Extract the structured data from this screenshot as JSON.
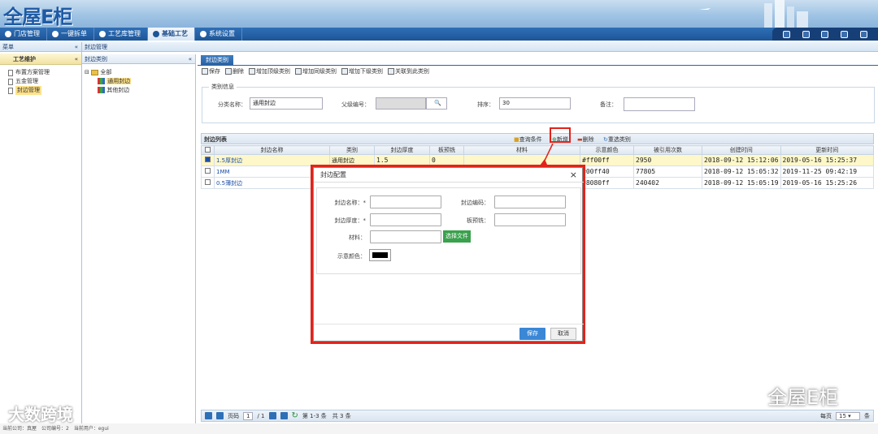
{
  "header": {
    "logo_text": "全屋E柜"
  },
  "nav": {
    "tabs": [
      {
        "label": "门店管理",
        "active": false
      },
      {
        "label": "一键拆单",
        "active": false
      },
      {
        "label": "工艺库管理",
        "active": false
      },
      {
        "label": "基础工艺",
        "active": true
      },
      {
        "label": "系统设置",
        "active": false
      }
    ]
  },
  "left_panel": {
    "bar_label": "菜单",
    "section_title": "工艺维护",
    "items": [
      {
        "label": "布置方案管理",
        "selected": false
      },
      {
        "label": "五金管理",
        "selected": false
      },
      {
        "label": "封边管理",
        "selected": true
      }
    ]
  },
  "breadcrumb": "封边管理",
  "middle_panel": {
    "title": "封边类别",
    "tree_root": "全部",
    "tree_children": [
      "通用封边",
      "其他封边"
    ]
  },
  "content": {
    "tab_label": "封边类别",
    "toolbar": [
      "保存",
      "删除",
      "增加顶级类别",
      "增加同级类别",
      "增加下级类别",
      "关联到此类别"
    ],
    "category_info": {
      "legend": "类别信息",
      "name_label": "分类名称：",
      "name_value": "通用封边",
      "parent_label": "父级编号：",
      "order_label": "排序：",
      "order_value": "30",
      "remark_label": "备注："
    },
    "list": {
      "title": "封边列表",
      "actions": [
        "查询条件",
        "新增",
        "删除",
        "重选类别"
      ],
      "columns": [
        "封边名称",
        "类别",
        "封边厚度",
        "板预铣",
        "材料",
        "示意颜色",
        "被引用次数",
        "创建时间",
        "更新时间"
      ],
      "rows": [
        {
          "checked": true,
          "name": "1.5厚封边",
          "type": "通用封边",
          "thickness": "1.5",
          "premill": "0",
          "material": "",
          "color": "#ff00ff",
          "refs": "2950",
          "created": "2018-09-12 15:12:06",
          "updated": "2019-05-16 15:25:37"
        },
        {
          "checked": false,
          "name": "1MM",
          "type": "",
          "thickness": "",
          "premill": "",
          "material": "",
          "color": "#00ff40",
          "refs": "77805",
          "created": "2018-09-12 15:05:32",
          "updated": "2019-11-25 09:42:19"
        },
        {
          "checked": false,
          "name": "0.5薄封边",
          "type": "",
          "thickness": "",
          "premill": "",
          "material": "",
          "color": "#8080ff",
          "refs": "240402",
          "created": "2018-09-12 15:05:19",
          "updated": "2019-05-16 15:25:26"
        }
      ]
    },
    "pager": {
      "page_label": "页码",
      "page_value": "1",
      "page_total": "/ 1",
      "summary": "第 1-3 条　共 3 条",
      "per_page_label": "每页",
      "per_page_value": "15",
      "per_page_unit": "条"
    }
  },
  "dialog": {
    "title": "封边配置",
    "close": "×",
    "fields": {
      "name_label": "封边名称：*",
      "code_label": "封边编码：",
      "thickness_label": "封边厚度：*",
      "premill_label": "板预铣：",
      "material_label": "材料：",
      "color_label": "示意颜色："
    },
    "select_file": "选择文件",
    "save": "保存",
    "cancel": "取消",
    "color_value": "#000000"
  },
  "statusbar": "当前公司：真屋　公司编号：2　当前用户：egui",
  "watermarks": {
    "left": "大数跨境",
    "right": "全屋E柜"
  }
}
